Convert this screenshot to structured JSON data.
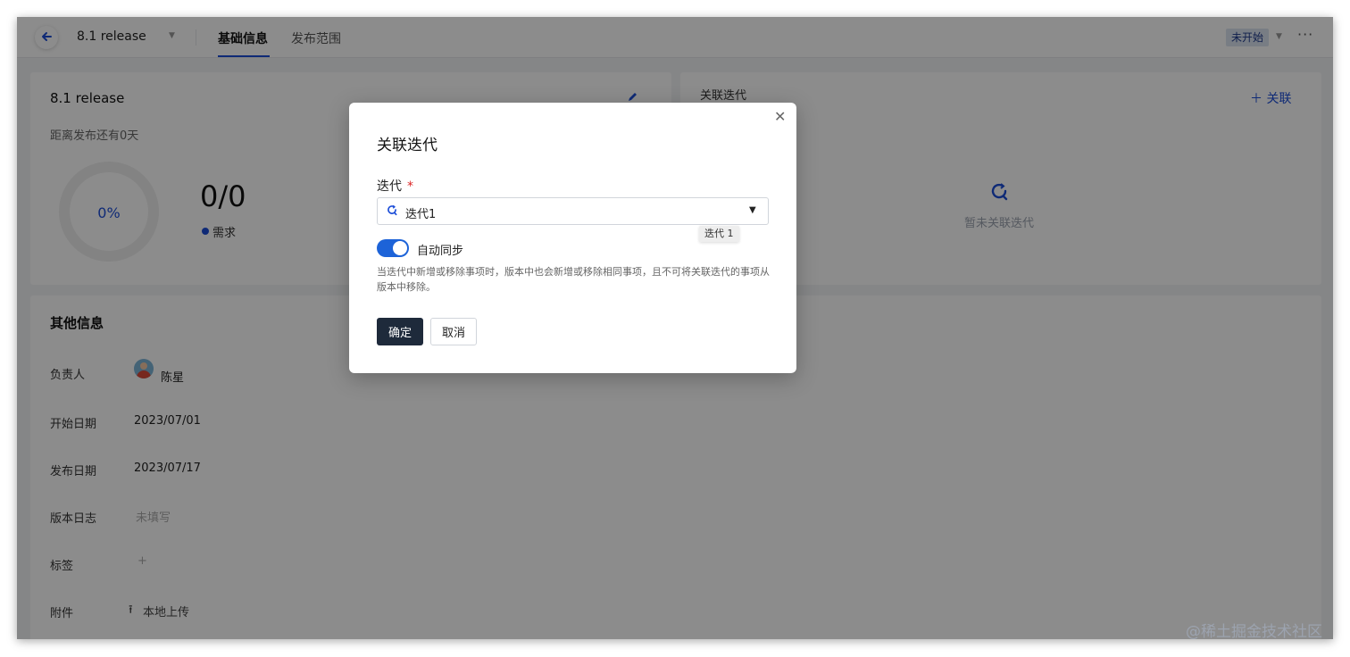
{
  "header": {
    "release_title": "8.1 release",
    "tabs": [
      {
        "label": "基础信息",
        "active": true
      },
      {
        "label": "发布范围",
        "active": false
      }
    ],
    "status": "未开始"
  },
  "release_card": {
    "name": "8.1 release",
    "days_left": "距离发布还有0天",
    "progress_pct": "0%",
    "count": "0/0",
    "legend": "需求"
  },
  "iteration_card": {
    "title": "关联迭代",
    "link_action": "关联",
    "empty_text": "暂未关联迭代"
  },
  "other_info": {
    "title": "其他信息",
    "fields": [
      {
        "label": "负责人",
        "value": "陈星"
      },
      {
        "label": "开始日期",
        "value": "2023/07/01"
      },
      {
        "label": "发布日期",
        "value": "2023/07/17"
      },
      {
        "label": "版本日志",
        "value": "未填写"
      },
      {
        "label": "标签",
        "value": "+"
      },
      {
        "label": "附件",
        "value": "本地上传"
      }
    ]
  },
  "modal": {
    "title": "关联迭代",
    "field_label": "迭代",
    "required_mark": "*",
    "selected_value": "迭代1",
    "tooltip": "迭代 1",
    "toggle_label": "自动同步",
    "toggle_on": true,
    "hint": "当迭代中新增或移除事项时，版本中也会新增或移除相同事项，且不可将关联迭代的事项从版本中移除。",
    "confirm_label": "确定",
    "cancel_label": "取消"
  },
  "watermark": "@稀土掘金技术社区",
  "colors": {
    "accent": "#1d4ed8",
    "primary_button": "#1e2a3b",
    "toggle_on": "#1d63d8",
    "required": "#dc2626"
  }
}
